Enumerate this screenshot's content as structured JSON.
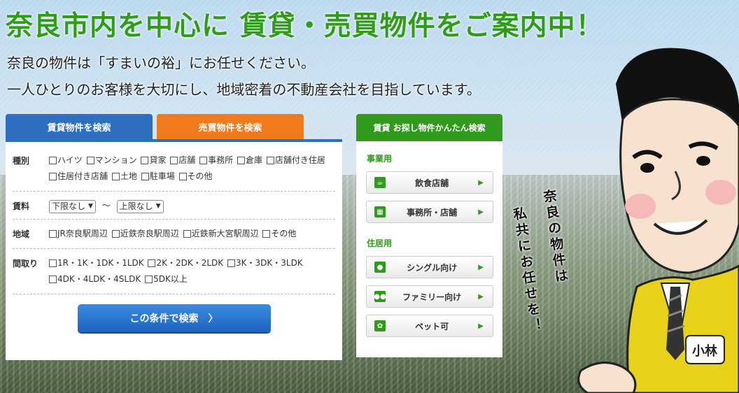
{
  "header": {
    "headline": "奈良市内を中心に 賃貸・売買物件をご案内中！",
    "intro_line1": "奈良の物件は「すまいの裕」にお任せください。",
    "intro_line2": "一人ひとりのお客様を大切にし、地域密着の不動産会社を目指しています。"
  },
  "search": {
    "tabs": [
      {
        "label": "賃貸物件を検索",
        "active": true
      },
      {
        "label": "売買物件を検索",
        "active": false
      }
    ],
    "rows": {
      "type": {
        "label": "種別",
        "options": [
          "ハイツ",
          "マンション",
          "貸家",
          "店舗",
          "事務所",
          "倉庫",
          "店舗付き住居",
          "住居付き店舗",
          "土地",
          "駐車場",
          "その他"
        ]
      },
      "rent": {
        "label": "賃料",
        "min_value": "下限なし",
        "separator": "〜",
        "max_value": "上限なし"
      },
      "area": {
        "label": "地域",
        "options": [
          "JR奈良駅周辺",
          "近鉄奈良駅周辺",
          "近鉄新大宮駅周辺",
          "その他"
        ]
      },
      "layout": {
        "label": "間取り",
        "options": [
          "1R・1K・1DK・1LDK",
          "2K・2DK・2LDK",
          "3K・3DK・3LDK",
          "4DK・4LDK・4SLDK",
          "5DK以上"
        ]
      }
    },
    "submit_label": "この条件で検索",
    "submit_arrow": "〉"
  },
  "quick": {
    "title": "賃貸 お探し物件かんたん検索",
    "groups": [
      {
        "title": "事業用",
        "items": [
          {
            "label": "飲食店舗",
            "icon": "cup-icon"
          },
          {
            "label": "事務所・店舗",
            "icon": "building-icon"
          }
        ]
      },
      {
        "title": "住居用",
        "items": [
          {
            "label": "シングル向け",
            "icon": "single-person-icon"
          },
          {
            "label": "ファミリー向け",
            "icon": "family-icon"
          },
          {
            "label": "ペット可",
            "icon": "paw-icon"
          }
        ]
      }
    ]
  },
  "mascot": {
    "vertical_text_1": "奈良の物件は",
    "vertical_text_2": "私共にお任せを！",
    "nametag": "小林"
  },
  "colors": {
    "green": "#2f9a1b",
    "blue": "#2f6fc0",
    "orange": "#f17a1c"
  }
}
